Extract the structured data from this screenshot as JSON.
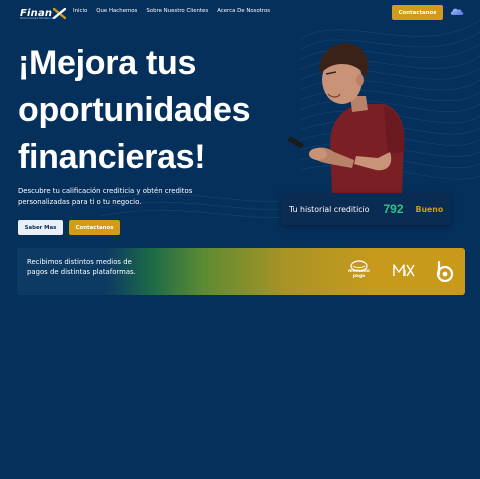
{
  "header": {
    "logo_text": "Finan",
    "logo_tagline": "Soluciones Modernas",
    "nav": [
      "Inicio",
      "Que Hachemos",
      "Sobre Nuestro Clientes",
      "Acerca De Nosotros"
    ],
    "contact_button": "Contactanos",
    "cloud_icon": "cloud-icon"
  },
  "hero": {
    "title_lines": [
      "¡Mejora tus",
      "oportunidades",
      "financieras!"
    ],
    "description": "Descubre tu calificación crediticia y obtén creditos personalizadas para ti o tu negocio.",
    "buttons": {
      "more": "Saber Mas",
      "contact": "Contactanos"
    }
  },
  "credit": {
    "label": "Tu historial crediticio",
    "score": "792",
    "status": "Bueno"
  },
  "payments": {
    "text": "Recibimos distintos medios de pagos de distintas plataformas.",
    "logos": {
      "mercado_pago_line1": "mercado",
      "mercado_pago_line2": "pago"
    }
  },
  "colors": {
    "background": "#06305c",
    "accent": "#d29b18",
    "score_green": "#2fc28a"
  }
}
